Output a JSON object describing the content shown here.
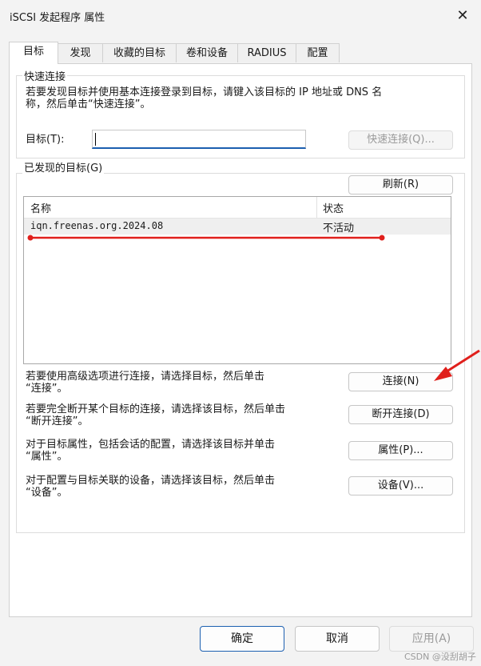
{
  "window": {
    "title": "iSCSI 发起程序 属性",
    "close_glyph": "✕"
  },
  "tabs": [
    {
      "label": "目标",
      "active": true
    },
    {
      "label": "发现"
    },
    {
      "label": "收藏的目标"
    },
    {
      "label": "卷和设备"
    },
    {
      "label": "RADIUS"
    },
    {
      "label": "配置"
    }
  ],
  "quick_connect": {
    "group_label": "快速连接",
    "description_line1": "若要发现目标并使用基本连接登录到目标，请键入该目标的 IP 地址或 DNS 名",
    "description_line2": "称，然后单击“快速连接”。",
    "target_label": "目标(T):",
    "target_value": "",
    "button": "快速连接(Q)..."
  },
  "discovered": {
    "group_label": "已发现的目标(G)",
    "refresh_button": "刷新(R)",
    "columns": [
      "名称",
      "状态"
    ],
    "rows": [
      {
        "name": "iqn.freenas.org.2024.08",
        "status": "不活动"
      }
    ]
  },
  "actions": [
    {
      "line1": "若要使用高级选项进行连接，请选择目标，然后单击",
      "line2": "“连接”。",
      "button": "连接(N)"
    },
    {
      "line1": "若要完全断开某个目标的连接，请选择该目标，然后单击",
      "line2": "“断开连接”。",
      "button": "断开连接(D)"
    },
    {
      "line1": "对于目标属性，包括会话的配置，请选择该目标并单击",
      "line2": "“属性”。",
      "button": "属性(P)..."
    },
    {
      "line1": "对于配置与目标关联的设备，请选择该目标，然后单击",
      "line2": "“设备”。",
      "button": "设备(V)..."
    }
  ],
  "footer": {
    "ok": "确定",
    "cancel": "取消",
    "apply": "应用(A)"
  },
  "watermark": "CSDN @没刮胡子",
  "colors": {
    "accent": "#1c5fb0",
    "annotation": "#e0201c"
  }
}
